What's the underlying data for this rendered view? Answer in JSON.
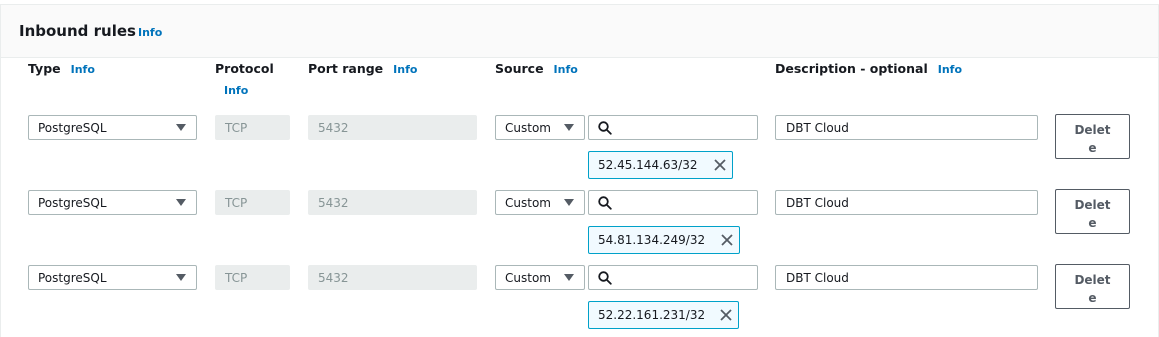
{
  "panel": {
    "title": "Inbound rules",
    "info": "Info"
  },
  "columns": {
    "type": "Type",
    "protocol": "Protocol",
    "port_range": "Port range",
    "source": "Source",
    "description": "Description - optional",
    "info": "Info"
  },
  "rules": [
    {
      "type": "PostgreSQL",
      "protocol": "TCP",
      "port": "5432",
      "source_type": "Custom",
      "search": "",
      "cidr": "52.45.144.63/32",
      "description": "DBT Cloud",
      "delete_label": "Delete"
    },
    {
      "type": "PostgreSQL",
      "protocol": "TCP",
      "port": "5432",
      "source_type": "Custom",
      "search": "",
      "cidr": "54.81.134.249/32",
      "description": "DBT Cloud",
      "delete_label": "Delete"
    },
    {
      "type": "PostgreSQL",
      "protocol": "TCP",
      "port": "5432",
      "source_type": "Custom",
      "search": "",
      "cidr": "52.22.161.231/32",
      "description": "DBT Cloud",
      "delete_label": "Delete"
    }
  ]
}
